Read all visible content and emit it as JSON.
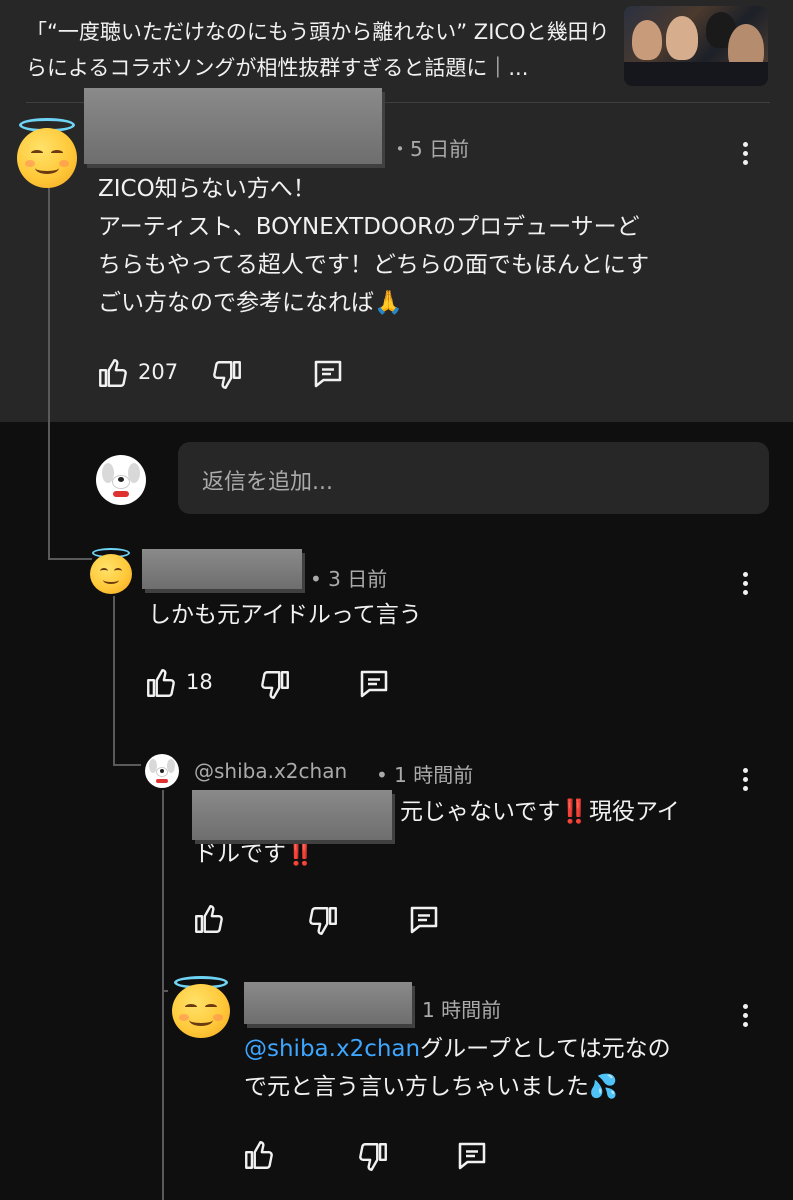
{
  "video": {
    "title": "「“一度聴いただけなのにもう頭から離れない” ZICOと幾田りらによるコラボソングが相性抜群すぎると話題に｜..."
  },
  "comments": {
    "top": {
      "time": "・5 日前",
      "text_lines": [
        "ZICO知らない方へ！",
        "アーティスト、BOYNEXTDOORのプロデューサーど",
        "ちらもやってる超人です！どちらの面でもほんとにす",
        "ごい方なので参考になれば🙏"
      ],
      "likes": "207"
    },
    "reply_box": {
      "placeholder": "返信を追加..."
    },
    "reply1": {
      "time": "• 3 日前",
      "text": "しかも元アイドルって言う",
      "likes": "18"
    },
    "reply2": {
      "handle": "@shiba.x2chan",
      "time": "• 1 時間前",
      "text_line1": "元じゃないです‼️現役アイ",
      "text_line2": "ドルです‼️"
    },
    "reply3": {
      "time": "1 時間前",
      "mention": "@shiba.x2chan",
      "text_line1_rest": "グループとしては元なの",
      "text_line2": "で元と言う言い方しちゃいました💦"
    }
  },
  "colors": {
    "background": "#0f0f0f",
    "highlight": "#272727",
    "mention": "#3ea6ff",
    "muted": "#aaaaaa"
  }
}
